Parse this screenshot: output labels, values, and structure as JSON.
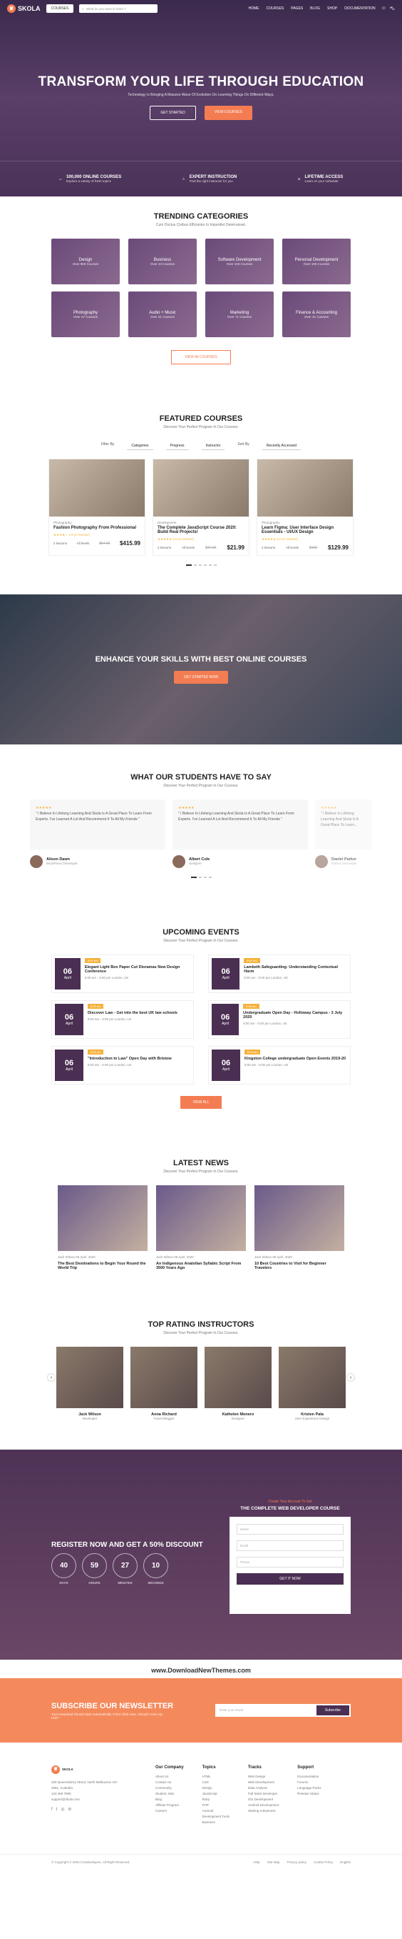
{
  "nav": {
    "logo": "SKOLA",
    "courses_btn": "COURSES",
    "search_placeholder": "What do you want to learn ?",
    "menu": [
      "HOME",
      "COURSES",
      "PAGES",
      "BLOG",
      "SHOP",
      "DOCUMENTATION"
    ]
  },
  "hero": {
    "title": "TRANSFORM YOUR LIFE THROUGH EDUCATION",
    "subtitle": "Technology Is Bringing A Massive Wave Of Evolution On Learning Things On Different Ways.",
    "btn1": "GET STARTED",
    "btn2": "VIEW COURSES"
  },
  "features": [
    {
      "title": "100,000 ONLINE COURSES",
      "desc": "Explore a variety of fresh topics"
    },
    {
      "title": "EXPERT INSTRUCTION",
      "desc": "Find the right instructor for you"
    },
    {
      "title": "LIFETIME ACCESS",
      "desc": "Learn on your schedule"
    }
  ],
  "trending": {
    "title": "TRENDING CATEGORIES",
    "sub": "Cum Doctus Civibus Efficiantur In Imperdiet Deterruisset.",
    "btn": "VIEW All COURSES",
    "cats": [
      {
        "n": "Design",
        "c": "Over 960 Courses"
      },
      {
        "n": "Business",
        "c": "Over 43 Courses"
      },
      {
        "n": "Software Development",
        "c": "Over 103 Courses"
      },
      {
        "n": "Personal Development",
        "c": "Over 109 Courses"
      },
      {
        "n": "Photography",
        "c": "Over 37 Courses"
      },
      {
        "n": "Audio + Music",
        "c": "Over 51 Courses"
      },
      {
        "n": "Marketing",
        "c": "Over 71 Courses"
      },
      {
        "n": "Finance & Accounting",
        "c": "Over 41 Courses"
      }
    ]
  },
  "featured": {
    "title": "FEATURED COURSES",
    "sub": "Discover Your Perfect Program In Our Courses.",
    "filters": {
      "filter": "Filter By",
      "categories": "Categories",
      "progress": "Progress",
      "instructor": "Instructor",
      "sort": "Sort By",
      "recent": "Recently Accessed"
    },
    "cards": [
      {
        "cat": "Photography",
        "title": "Fashion Photography From Professional",
        "rating": "★★★★☆ 4.9 (2 reviews)",
        "lessons": "2 lessons",
        "level": "All levels",
        "old": "$54.99",
        "price": "$415.99"
      },
      {
        "cat": "Development",
        "title": "The Complete JavaScript Course 2020: Build Real Projects!",
        "rating": "★★★★★ 4.9 (2 reviews)",
        "lessons": "2 lessons",
        "level": "All levels",
        "old": "$37.99",
        "price": "$21.99"
      },
      {
        "cat": "Photography",
        "title": "Learn Figma: User Interface Design Essentials - UI/UX Design",
        "rating": "★★★★★ 5.0 (2 reviews)",
        "lessons": "2 lessons",
        "level": "All levels",
        "old": "$109",
        "price": "$129.99"
      }
    ]
  },
  "banner": {
    "title": "ENHANCE YOUR SKILLS WITH BEST ONLINE COURSES",
    "btn": "GET STARTED NOW"
  },
  "testimonials": {
    "title": "WHAT OUR STUDENTS HAVE TO SAY",
    "sub": "Discover Your Perfect Program In Our Courses.",
    "items": [
      {
        "text": "\" I Believe In Lifelong Learning And Skola Is A Great Place To Learn From Experts. I've Learned A Lot And Recommend It To All My Friends \"",
        "name": "Alison Dawn",
        "role": "WordPress Developer"
      },
      {
        "text": "\" I Believe In Lifelong Learning And Skola Is A Great Place To Learn From Experts. I've Learned A Lot And Recommend It To All My Friends \"",
        "name": "Albert Cole",
        "role": "Designer"
      },
      {
        "text": "\" I Believe In Lifelong Learning And Skola Is A Great Place To Learn...",
        "name": "Daniel Parker",
        "role": "Python Developer"
      }
    ]
  },
  "events": {
    "title": "UPCOMING EVENTS",
    "sub": "Discover Your Perfect Program In Our Courses.",
    "btn": "VIEW ALL",
    "items": [
      {
        "d": "06",
        "m": "April",
        "tag": "8:00 am",
        "t": "Elegant Light Box Paper Cut Dioramas New Design Conference",
        "meta": "8:00 am - 5:00 pm   London, UK"
      },
      {
        "d": "06",
        "m": "April",
        "tag": "8:00 am",
        "t": "Lambeth Safeguarding: Understanding Contextual Harm",
        "meta": "8:00 am - 5:00 pm   London, UK"
      },
      {
        "d": "06",
        "m": "April",
        "tag": "8:00 am",
        "t": "Discover Law - Get into the best UK law schools",
        "meta": "8:00 am - 5:00 pm   London, UK"
      },
      {
        "d": "06",
        "m": "April",
        "tag": "8:00 am",
        "t": "Undergraduate Open Day - Holloway Campus - 3 July 2020",
        "meta": "8:00 am - 5:00 pm   London, UK"
      },
      {
        "d": "06",
        "m": "April",
        "tag": "8:00 am",
        "t": "\"Introduction to Law\" Open Day with Bristow",
        "meta": "8:00 am - 5:00 pm   London, UK"
      },
      {
        "d": "06",
        "m": "April",
        "tag": "8:00 am",
        "t": "Kingston College undergraduate Open Events 2019-20",
        "meta": "8:00 am - 5:00 pm   London, UK"
      }
    ]
  },
  "news": {
    "title": "LATEST NEWS",
    "sub": "Discover Your Perfect Program In Our Courses.",
    "items": [
      {
        "meta": "Jack Wilson   06 April, 2020",
        "t": "The Best Destinations to Begin Your Round the World Trip"
      },
      {
        "meta": "Jack Wilson   06 April, 2020",
        "t": "An Indigenous Anatolian Syllabic Script From 3500 Years Ago"
      },
      {
        "meta": "Jack Wilson   06 April, 2020",
        "t": "10 Best Countries to Visit for Beginner Travelers"
      }
    ]
  },
  "instructors": {
    "title": "TOP RATING INSTRUCTORS",
    "sub": "Discover Your Perfect Program In Our Courses.",
    "items": [
      {
        "n": "Jack Wilson",
        "r": "Developer"
      },
      {
        "n": "Anna Richard",
        "r": "Travel Blogger"
      },
      {
        "n": "Kathelen Monero",
        "r": "Designer"
      },
      {
        "n": "Kristen Pala",
        "r": "User Experience Design"
      }
    ]
  },
  "register": {
    "title": "REGISTER NOW AND GET A 50% DISCOUNT",
    "timer": [
      {
        "v": "40",
        "l": "DAYS"
      },
      {
        "v": "59",
        "l": "HOURS"
      },
      {
        "v": "27",
        "l": "MINUTES"
      },
      {
        "v": "10",
        "l": "SECONDS"
      }
    ],
    "form_small": "Create Your Account To Get",
    "form_big": "THE COMPLETE WEB DEVELOPER COURSE",
    "fields": [
      "Name",
      "Email",
      "Phone"
    ],
    "submit": "GET IT NOW"
  },
  "watermark": "www.DownloadNewThemes.com",
  "newsletter": {
    "title": "SUBSCRIBE OUR NEWSLETTER",
    "text": "Your Download Should Start Automatically. If Not Click Here. Should I Give Up, Huh?",
    "placeholder": "Enter your email",
    "btn": "Subscribe"
  },
  "footer": {
    "address": "329 Queensberry Street, North Melbourne VIC 3051, Australia.",
    "phone": "123 456 7890",
    "email": "support@skola.com",
    "cols": [
      {
        "h": "Our Company",
        "items": [
          "Our Company",
          "About Us",
          "Contact Us",
          "Community",
          "Student Jobs",
          "Blog",
          "Affiliate Program",
          "Careers"
        ]
      },
      {
        "h": "Topics",
        "items": [
          "HTML",
          "CSS",
          "Design",
          "JavaScript",
          "Ruby",
          "PHP",
          "Android",
          "Development Tools",
          "Business"
        ]
      },
      {
        "h": "Tracks",
        "items": [
          "Web Design",
          "Web Development",
          "Data Analysis",
          "Full Stack Developer",
          "iOS Development",
          "Android Development",
          "Starting a Business"
        ]
      },
      {
        "h": "Support",
        "items": [
          "Documentation",
          "Forums",
          "Language Packs",
          "Release Status"
        ]
      }
    ],
    "copyright": "© Copyright © 2020 Creativelayers. All Right Reserved.",
    "links": [
      "Help",
      "Site Map",
      "Privacy policy",
      "Cookie Policy"
    ],
    "lang": "English"
  }
}
